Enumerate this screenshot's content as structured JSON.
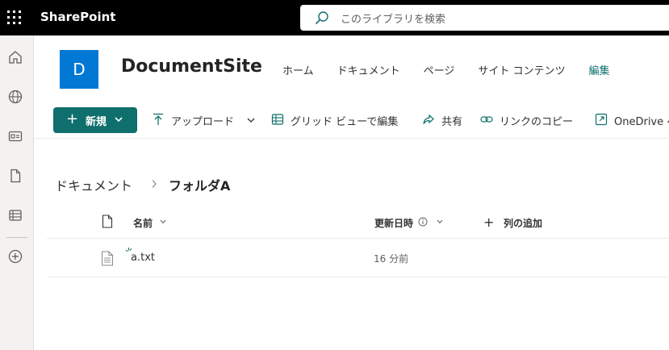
{
  "suite": {
    "app_name": "SharePoint",
    "search_placeholder": "このライブラリを検索"
  },
  "rail": {
    "items": [
      "home-icon",
      "globe-icon",
      "news-icon",
      "file-icon",
      "lists-icon",
      "create-icon"
    ]
  },
  "site": {
    "logo_letter": "D",
    "title": "DocumentSite",
    "nav": [
      "ホーム",
      "ドキュメント",
      "ページ",
      "サイト コンテンツ",
      "編集"
    ],
    "active_nav": "編集"
  },
  "commands": {
    "new_label": "新規",
    "upload_label": "アップロード",
    "grid_edit_label": "グリッド ビューで編集",
    "share_label": "共有",
    "copy_link_label": "リンクのコピー",
    "onedrive_label": "OneDrive へ"
  },
  "breadcrumb": {
    "parent": "ドキュメント",
    "current": "フォルダA"
  },
  "table": {
    "col_name": "名前",
    "col_modified": "更新日時",
    "add_column": "列の追加",
    "rows": [
      {
        "name": "a.txt",
        "modified": "16 分前"
      }
    ]
  },
  "colors": {
    "suitebar": "#000000",
    "accent": "#0f6f6c",
    "logo": "#0078d4"
  }
}
